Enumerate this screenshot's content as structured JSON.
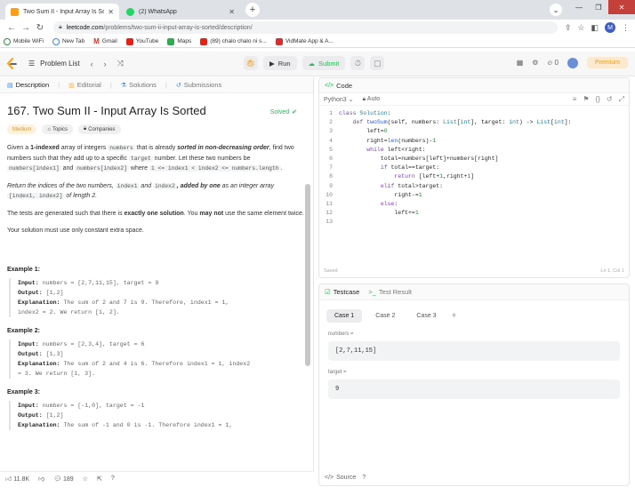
{
  "browser": {
    "tabs": [
      {
        "title": "Two Sum II - Input Array Is Sorte",
        "active": true,
        "favicon_color": "#f89f1b"
      },
      {
        "title": "(2) WhatsApp",
        "active": false,
        "favicon_color": "#25d366"
      }
    ],
    "url_host": "leetcode.com",
    "url_path": "/problems/two-sum-ii-input-array-is-sorted/description/",
    "profile_initial": "M",
    "bookmarks": [
      {
        "label": "Mobile WiFi",
        "color": "#2a8d3c"
      },
      {
        "label": "New Tab",
        "color": "#3b82f6"
      },
      {
        "label": "Gmail",
        "color": "#d93025"
      },
      {
        "label": "YouTube",
        "color": "#e62117"
      },
      {
        "label": "Maps",
        "color": "#34a853"
      },
      {
        "label": "(89) chalo chalo ni s...",
        "color": "#e62117"
      },
      {
        "label": "VidMate App & A...",
        "color": "#d32f2f"
      }
    ]
  },
  "leetcode_header": {
    "problem_list_label": "Problem List",
    "run_label": "Run",
    "submit_label": "Submit",
    "streak_count": "0",
    "premium_label": "Premium"
  },
  "left_tabs": [
    {
      "label": "Description",
      "active": true
    },
    {
      "label": "Editorial",
      "active": false
    },
    {
      "label": "Solutions",
      "active": false
    },
    {
      "label": "Submissions",
      "active": false
    }
  ],
  "problem": {
    "title": "167. Two Sum II - Input Array Is Sorted",
    "solved_label": "Solved",
    "tags": [
      "Medium",
      "Topics",
      "Companies"
    ],
    "para1_a": "Given a ",
    "para1_b": "1-indexed",
    "para1_c": " array of integers ",
    "para1_d": "numbers",
    "para1_e": " that is already ",
    "para1_f": "sorted in non-decreasing order",
    "para1_g": ", find two numbers such that they add up to a specific ",
    "para1_h": "target",
    "para1_i": " number. Let these two numbers be ",
    "para1_j": "numbers[index1]",
    "para1_k": " and ",
    "para1_l": "numbers[index2]",
    "para1_m": " where ",
    "para1_n": "1 <= index1 < index2 <= numbers.length",
    "para1_o": ".",
    "para2_a": "Return the indices of the two numbers, ",
    "para2_b": "index1",
    "para2_c": " and ",
    "para2_d": "index2",
    "para2_e": ", added by one",
    "para2_f": " as an integer array ",
    "para2_g": "[index1, index2]",
    "para2_h": " of length 2.",
    "para3_a": "The tests are generated such that there is ",
    "para3_b": "exactly one solution",
    "para3_c": ". You ",
    "para3_d": "may not",
    "para3_e": " use the same element twice.",
    "para4": "Your solution must use only constant extra space.",
    "examples": [
      {
        "heading": "Example 1:",
        "input": "numbers = [2,7,11,15], target = 9",
        "output": "[1,2]",
        "explanation1": "The sum of 2 and 7 is 9. Therefore, index1 = 1,",
        "explanation2": "index2 = 2. We return [1, 2]."
      },
      {
        "heading": "Example 2:",
        "input": "numbers = [2,3,4], target = 6",
        "output": "[1,3]",
        "explanation1": "The sum of 2 and 4 is 6. Therefore index1 = 1, index2",
        "explanation2": "= 3. We return [1, 3]."
      },
      {
        "heading": "Example 3:",
        "input": "numbers = [-1,0], target = -1",
        "output": "[1,2]",
        "explanation1": "The sum of -1 and 0 is -1. Therefore index1 = 1,",
        "explanation2": ""
      }
    ],
    "likes": "11.8K",
    "comments": "189"
  },
  "labels": {
    "input": "Input:",
    "output": "Output:",
    "explanation": "Explanation:"
  },
  "code_panel": {
    "title": "Code",
    "language": "Python3",
    "auto_label": "Auto",
    "saved_label": "Saved",
    "cursor_pos": "Ln 1, Col 1",
    "lines": [
      "class Solution:",
      "    def twoSum(self, numbers: List[int], target: int) -> List[int]:",
      "        left=0",
      "        right=len(numbers)-1",
      "        while left<right:",
      "            total=numbers[left]+numbers[right]",
      "            if total==target:",
      "                return [left+1,right+1]",
      "            elif total>target:",
      "                right-=1",
      "            else:",
      "                left+=1",
      ""
    ]
  },
  "test_panel": {
    "testcase_label": "Testcase",
    "result_label": "Test Result",
    "cases": [
      "Case 1",
      "Case 2",
      "Case 3"
    ],
    "params": [
      {
        "name": "numbers =",
        "value": "[2,7,11,15]"
      },
      {
        "name": "target =",
        "value": "9"
      }
    ],
    "source_label": "Source"
  },
  "colors": {
    "accent_green": "#2db55d",
    "medium_orange": "#d69a2c",
    "premium_orange": "#e3a02b"
  }
}
